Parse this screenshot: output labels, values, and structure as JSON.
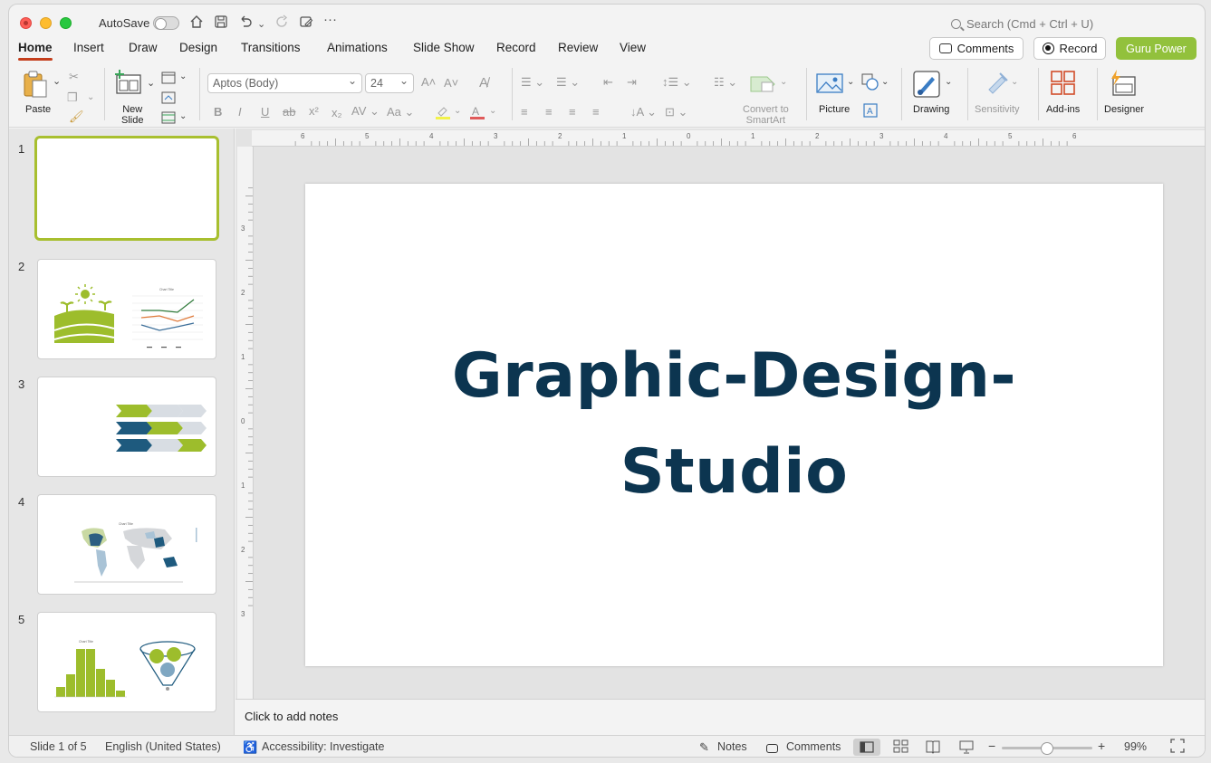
{
  "titlebar": {
    "autosave_label": "AutoSave",
    "search_placeholder": "Search (Cmd + Ctrl + U)"
  },
  "tabs": [
    "Home",
    "Insert",
    "Draw",
    "Design",
    "Transitions",
    "Animations",
    "Slide Show",
    "Record",
    "Review",
    "View"
  ],
  "active_tab": "Home",
  "header_buttons": {
    "comments": "Comments",
    "record": "Record",
    "guru": "Guru Power"
  },
  "ribbon": {
    "paste": "Paste",
    "new_slide": [
      "New",
      "Slide"
    ],
    "font_name": "Aptos (Body)",
    "font_size": "24",
    "convert_smartart": [
      "Convert to",
      "SmartArt"
    ],
    "picture": "Picture",
    "drawing": "Drawing",
    "sensitivity": "Sensitivity",
    "addins": "Add-ins",
    "designer": "Designer"
  },
  "slides": [
    {
      "number": "1",
      "selected": true
    },
    {
      "number": "2"
    },
    {
      "number": "3"
    },
    {
      "number": "4"
    },
    {
      "number": "5"
    }
  ],
  "thumb_text": {
    "chart_title": "Chart Title"
  },
  "slide": {
    "title_line1": "Graphic-Design-",
    "title_line2": "Studio"
  },
  "ruler": {
    "h_labels": [
      "6",
      "5",
      "4",
      "3",
      "2",
      "1",
      "0",
      "1",
      "2",
      "3",
      "4",
      "5",
      "6"
    ],
    "v_labels": [
      "3",
      "2",
      "1",
      "0",
      "1",
      "2",
      "3"
    ]
  },
  "notes_placeholder": "Click to add notes",
  "status": {
    "slide_count": "Slide 1 of 5",
    "language": "English (United States)",
    "accessibility": "Accessibility: Investigate",
    "notes": "Notes",
    "comments": "Comments",
    "zoom": "99%",
    "zoom_fraction": 0.5
  },
  "colors": {
    "accent": "#c43e1c",
    "title": "#0c3550",
    "lime": "#9dbd2c",
    "navy": "#1e5a7e",
    "guru": "#92c13c"
  }
}
